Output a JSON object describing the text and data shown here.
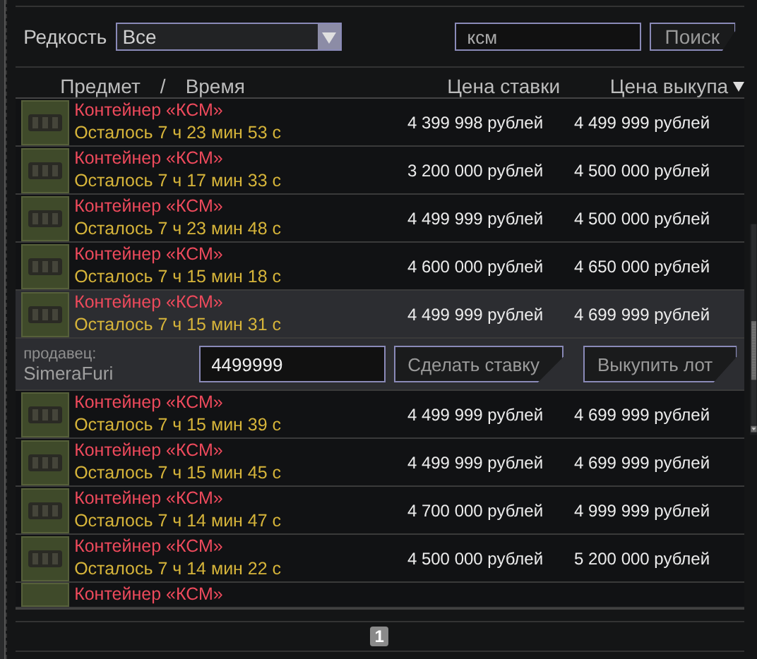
{
  "filter": {
    "label": "Редкость",
    "rarity": "Все",
    "search_value": "ксм",
    "search_button": "Поиск"
  },
  "table": {
    "columns": [
      {
        "label": "Предмет"
      },
      {
        "label": "/"
      },
      {
        "label": "Время"
      },
      {
        "label": "Цена ставки"
      },
      {
        "label": "Цена выкупа",
        "sorted": true
      }
    ],
    "rows": [
      {
        "name": "Контейнер «КСМ»",
        "timer": "Осталось 7 ч 23 мин 53 с",
        "bid": "4 399 998 рублей",
        "buyout": "4 499 999 рублей",
        "selected": false
      },
      {
        "name": "Контейнер «КСМ»",
        "timer": "Осталось 7 ч 17 мин 33 с",
        "bid": "3 200 000 рублей",
        "buyout": "4 500 000 рублей",
        "selected": false
      },
      {
        "name": "Контейнер «КСМ»",
        "timer": "Осталось 7 ч 23 мин 48 с",
        "bid": "4 499 999 рублей",
        "buyout": "4 500 000 рублей",
        "selected": false
      },
      {
        "name": "Контейнер «КСМ»",
        "timer": "Осталось 7 ч 15 мин 18 с",
        "bid": "4 600 000 рублей",
        "buyout": "4 650 000 рублей",
        "selected": false
      },
      {
        "name": "Контейнер «КСМ»",
        "timer": "Осталось 7 ч 15 мин 31 с",
        "bid": "4 499 999 рублей",
        "buyout": "4 699 999 рублей",
        "selected": true,
        "seller_label": "продавец:",
        "seller": "SimeraFuri",
        "bid_input": "4499999",
        "bid_button": "Сделать ставку",
        "buyout_button": "Выкупить лот"
      },
      {
        "name": "Контейнер «КСМ»",
        "timer": "Осталось 7 ч 15 мин 39 с",
        "bid": "4 499 999 рублей",
        "buyout": "4 699 999 рублей",
        "selected": false
      },
      {
        "name": "Контейнер «КСМ»",
        "timer": "Осталось 7 ч 15 мин 45 с",
        "bid": "4 499 999 рублей",
        "buyout": "4 699 999 рублей",
        "selected": false
      },
      {
        "name": "Контейнер «КСМ»",
        "timer": "Осталось 7 ч 14 мин 47 с",
        "bid": "4 700 000 рублей",
        "buyout": "4 999 999 рублей",
        "selected": false
      },
      {
        "name": "Контейнер «КСМ»",
        "timer": "Осталось 7 ч 14 мин 22 с",
        "bid": "4 500 000 рублей",
        "buyout": "5 200 000 рублей",
        "selected": false
      },
      {
        "name": "Контейнер «КСМ»",
        "selected": false
      }
    ]
  },
  "pager": {
    "pages": [
      {
        "label": "1",
        "selected": true
      }
    ]
  }
}
